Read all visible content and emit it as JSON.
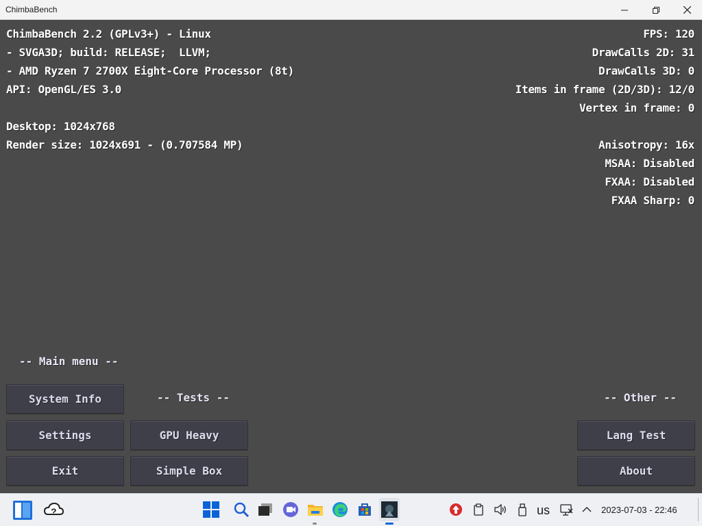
{
  "window": {
    "title": "ChimbaBench"
  },
  "info_left": [
    "ChimbaBench 2.2 (GPLv3+) - Linux",
    "- SVGA3D; build: RELEASE;  LLVM;",
    "- AMD Ryzen 7 2700X Eight-Core Processor (8t)",
    "API: OpenGL/ES 3.0",
    "Desktop: 1024x768",
    "Render size: 1024x691 - (0.707584 MP)"
  ],
  "info_right": [
    "FPS: 120",
    "DrawCalls 2D: 31",
    "DrawCalls 3D: 0",
    "Items in frame (2D/3D): 12/0",
    "Vertex in frame: 0",
    "Anisotropy: 16x",
    "MSAA: Disabled",
    "FXAA: Disabled",
    "FXAA Sharp: 0"
  ],
  "menu": {
    "main_label": "-- Main menu --",
    "tests_label": "-- Tests --",
    "other_label": "-- Other --",
    "system_info": "System Info",
    "settings": "Settings",
    "exit": "Exit",
    "gpu_heavy": "GPU Heavy",
    "simple_box": "Simple Box",
    "lang_test": "Lang Test",
    "about": "About"
  },
  "taskbar": {
    "keyboard_layout": "us",
    "datetime": "2023-07-03 - 22:46",
    "icons": [
      "start-icon",
      "weather-cloud-icon",
      "windows-start-icon",
      "search-icon",
      "task-view-icon",
      "chat-icon",
      "file-explorer-icon",
      "edge-icon",
      "store-icon",
      "chimbabench-icon"
    ],
    "colors": {
      "windows_blue": "#0a64d8",
      "accent_red": "#d92b2b"
    }
  }
}
